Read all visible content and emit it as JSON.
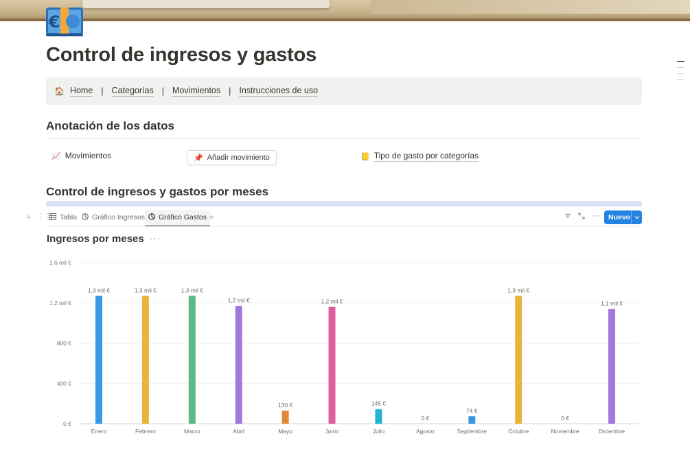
{
  "page": {
    "title": "Control de ingresos y gastos",
    "icon": "euro-banknote-icon"
  },
  "nav": {
    "house_icon": "🏠",
    "items": [
      "Home",
      "Categorías",
      "Movimientos",
      "Instrucciones de uso"
    ],
    "separator": "|"
  },
  "section1": {
    "heading": "Anotación de los datos",
    "movimientos_label": "Movimientos",
    "movimientos_icon": "📈",
    "add_button_label": "Añadir movimiento",
    "add_button_icon": "📌",
    "tipo_label": "Tipo de gasto por categorías",
    "tipo_icon": "📒"
  },
  "section2": {
    "heading": "Control de ingresos y gastos por meses"
  },
  "views": {
    "tabs": [
      {
        "label": "Tabla",
        "icon": "table-icon"
      },
      {
        "label": "Gráfico Ingresos",
        "icon": "pie-chart-icon"
      },
      {
        "label": "Gráfico Gastos",
        "icon": "pie-chart-icon",
        "active": true
      }
    ],
    "new_button_label": "Nuevo"
  },
  "chart_title": "Ingresos por meses",
  "chart_more": "···",
  "chart_data": {
    "type": "bar",
    "title": "Ingresos por meses",
    "xlabel": "",
    "ylabel": "",
    "ylim": [
      0,
      1600
    ],
    "y_ticks": [
      "0 €",
      "400 €",
      "800 €",
      "1,2 mil €",
      "1,6 mil €"
    ],
    "y_tick_values": [
      0,
      400,
      800,
      1200,
      1600
    ],
    "categories": [
      "Enero",
      "Febrero",
      "Marzo",
      "Abril",
      "Mayo",
      "Junio",
      "Julio",
      "Agosto",
      "Septiembre",
      "Octubre",
      "Noviembre",
      "Diciembre"
    ],
    "values": [
      1270,
      1270,
      1270,
      1170,
      130,
      1160,
      145,
      0,
      74,
      1270,
      0,
      1140
    ],
    "value_labels": [
      "1,3 mil €",
      "1,3 mil €",
      "1,3 mil €",
      "1,2 mil €",
      "130 €",
      "1,2 mil €",
      "145 €",
      "0 €",
      "74 €",
      "1,3 mil €",
      "0 €",
      "1,1 mil €"
    ],
    "colors": [
      "#3a98e6",
      "#e8b43c",
      "#5ab98a",
      "#a178dc",
      "#e4893a",
      "#df5e9e",
      "#23b3d3",
      "#a8a8a8",
      "#3a98e6",
      "#e8b43c",
      "#a8a8a8",
      "#a178dc"
    ],
    "grid": true,
    "legend": "none"
  }
}
